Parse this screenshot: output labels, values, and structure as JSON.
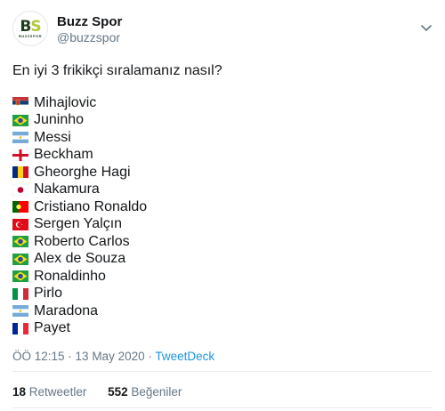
{
  "account": {
    "name": "Buzz Spor",
    "handle": "@buzzspor",
    "logo_text": "BS",
    "logo_sub": "BUZZSPOR"
  },
  "tweet": {
    "text": "En iyi 3 frikikçi sıralamanız nasıl?",
    "players": [
      {
        "name": "Mihajlovic",
        "flag": "serbia-flag"
      },
      {
        "name": "Juninho",
        "flag": "brazil-flag"
      },
      {
        "name": "Messi",
        "flag": "argentina-flag"
      },
      {
        "name": "Beckham",
        "flag": "england-flag"
      },
      {
        "name": "Gheorghe Hagi",
        "flag": "romania-flag"
      },
      {
        "name": "Nakamura",
        "flag": "japan-flag"
      },
      {
        "name": "Cristiano Ronaldo",
        "flag": "portugal-flag"
      },
      {
        "name": "Sergen Yalçın",
        "flag": "turkey-flag"
      },
      {
        "name": "Roberto Carlos",
        "flag": "brazil-flag"
      },
      {
        "name": "Alex de Souza",
        "flag": "brazil-flag"
      },
      {
        "name": "Ronaldinho",
        "flag": "brazil-flag"
      },
      {
        "name": "Pirlo",
        "flag": "italy-flag"
      },
      {
        "name": "Maradona",
        "flag": "argentina-flag"
      },
      {
        "name": "Payet",
        "flag": "france-flag"
      }
    ]
  },
  "meta": {
    "time": "ÖÖ 12:15",
    "separator1": " · ",
    "date": "13 May 2020",
    "separator2": " · ",
    "source": "TweetDeck"
  },
  "stats": {
    "retweets_count": "18",
    "retweets_label": "Retweetler",
    "likes_count": "552",
    "likes_label": "Beğeniler"
  },
  "colors": {
    "link": "#1b95e0",
    "muted": "#657786",
    "text": "#14171a"
  }
}
